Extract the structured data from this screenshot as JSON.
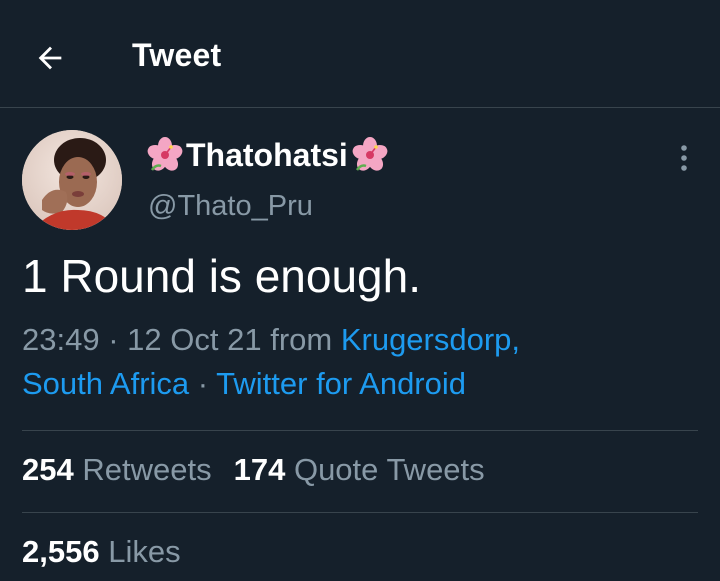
{
  "header": {
    "back_icon": "arrow-left-icon",
    "title": "Tweet"
  },
  "tweet": {
    "author": {
      "name": "Thatohatsi",
      "name_emoji": "hibiscus-icon",
      "handle": "@Thato_Pru"
    },
    "more_icon": "more-vertical-icon",
    "text": "1 Round is enough.",
    "time": "23:49",
    "separator": "·",
    "date": "12 Oct 21",
    "from_label": "from",
    "location_line1": "Krugersdorp,",
    "location_line2": "South Africa",
    "source": "Twitter for Android"
  },
  "stats": {
    "retweets_count": "254",
    "retweets_label": "Retweets",
    "quotes_count": "174",
    "quotes_label": "Quote Tweets",
    "likes_count": "2,556",
    "likes_label": "Likes"
  },
  "colors": {
    "background": "#15202b",
    "divider": "#38444d",
    "secondary_text": "#8899a6",
    "link": "#1d9bf0"
  }
}
